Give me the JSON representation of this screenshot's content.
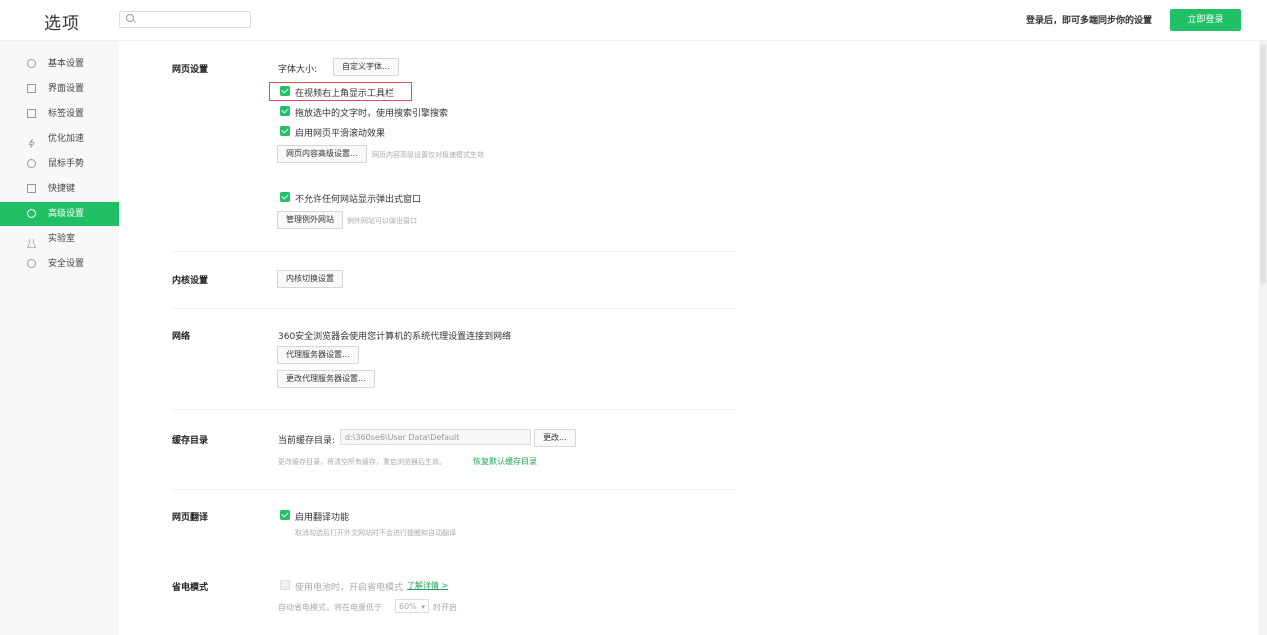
{
  "header": {
    "title": "选项",
    "search_placeholder": "",
    "login_hint": "登录后，即可多端同步你的设置",
    "login_button": "立即登录"
  },
  "sidebar": {
    "items": [
      {
        "label": "基本设置",
        "icon": "gear-icon"
      },
      {
        "label": "界面设置",
        "icon": "window-icon"
      },
      {
        "label": "标签设置",
        "icon": "tab-icon"
      },
      {
        "label": "优化加速",
        "icon": "lightning-icon"
      },
      {
        "label": "鼠标手势",
        "icon": "mouse-icon"
      },
      {
        "label": "快捷键",
        "icon": "keyboard-icon"
      },
      {
        "label": "高级设置",
        "icon": "advanced-icon"
      },
      {
        "label": "实验室",
        "icon": "flask-icon"
      },
      {
        "label": "安全设置",
        "icon": "shield-icon"
      }
    ],
    "active_index": 6
  },
  "webpage": {
    "title": "网页设置",
    "font_size_label": "字体大小:",
    "custom_font_button": "自定义字体...",
    "cb_video_toolbar": "在视频右上角显示工具栏",
    "cb_drag_search": "拖放选中的文字时，使用搜索引擎搜索",
    "cb_smooth_scroll": "启用网页平滑滚动效果",
    "advanced_content_button": "网页内容高级设置...",
    "advanced_content_hint": "网页内容高级设置仅对极速模式生效",
    "cb_no_popups": "不允许任何网站显示弹出式窗口",
    "manage_exceptions_button": "管理例外网站",
    "manage_exceptions_hint": "例外网站可以弹出窗口"
  },
  "kernel": {
    "title": "内核设置",
    "switch_button": "内核切换设置"
  },
  "network": {
    "title": "网络",
    "description": "360安全浏览器会使用您计算机的系统代理设置连接到网络",
    "proxy_button": "代理服务器设置...",
    "change_proxy_button": "更改代理服务器设置..."
  },
  "cache": {
    "title": "缓存目录",
    "current_label": "当前缓存目录:",
    "path_value": "d:\\360se6\\User Data\\Default",
    "change_button": "更改...",
    "hint": "更改缓存目录，将清空所有缓存，重启浏览器后生效。",
    "restore_link": "恢复默认缓存目录"
  },
  "translate": {
    "title": "网页翻译",
    "cb_enable": "启用翻译功能",
    "hint": "取消勾选后打开外文网站时不会进行提醒和自动翻译"
  },
  "power": {
    "title": "省电模式",
    "cb_battery": "使用电池时，开启省电模式",
    "detail_link": "了解详情 >",
    "auto_prefix": "自动省电模式，将在电量低于",
    "auto_value": "60%",
    "auto_suffix": "时开启"
  },
  "colors": {
    "accent": "#21c065",
    "highlight_border": "#d9534f"
  }
}
